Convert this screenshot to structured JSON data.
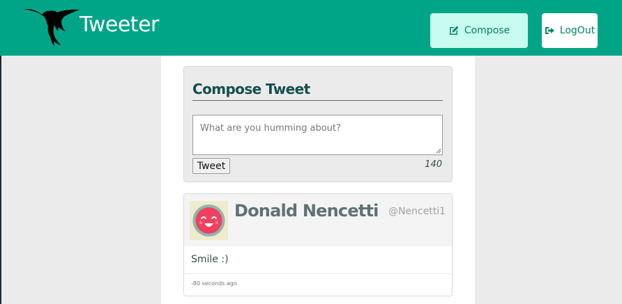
{
  "header": {
    "app_title": "Tweeter",
    "logo_icon": "hummingbird-icon",
    "compose_button": {
      "label": "Compose",
      "icon": "edit-icon"
    },
    "logout_button": {
      "label": "LogOut",
      "icon": "sign-out-icon"
    }
  },
  "compose": {
    "title": "Compose Tweet",
    "placeholder": "What are you humming about?",
    "submit_label": "Tweet",
    "char_count": "140"
  },
  "tweets": [
    {
      "avatar_icon": "smiley-avatar-icon",
      "name": "Donald Nencetti",
      "handle": "@Nencetti1",
      "content": "Smile :)",
      "timestamp": "-80 seconds ago"
    }
  ],
  "colors": {
    "header_bg": "#00a587",
    "compose_button_bg": "#c8fcee",
    "title_text": "#144e4e",
    "page_bg": "#ebebeb"
  }
}
